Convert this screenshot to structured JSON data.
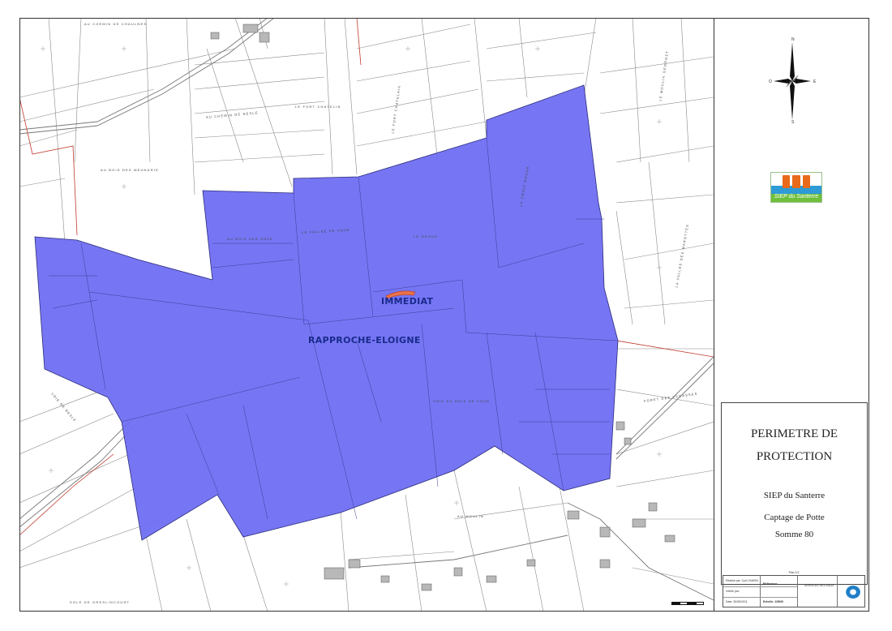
{
  "title": {
    "line1": "PERIMETRE DE",
    "line2": "PROTECTION",
    "organization": "SIEP du Santerre",
    "project": "Captage de Potte",
    "department": "Somme 80"
  },
  "logo": {
    "text": "SIEP du Santerre",
    "bar_color": "#e86a1a"
  },
  "map_labels": {
    "immediat": "IMMEDIAT",
    "rapproche": "RAPPROCHE-ELOIGNE"
  },
  "colors": {
    "protection_zone": "#6f6ff3",
    "immediate_zone": "#e8714a",
    "parcel_lines": "#7a7a7a",
    "commune_boundary": "#c0392b"
  },
  "place_names": [
    "AU CHEMIN DE CHAULNES",
    "AU CHEMIN DE NESLE",
    "LE FORT CHATELIN",
    "LE FORT CHATELAIN",
    "AU BOIS DES MEUNDRIE",
    "AU BOIS DES ONZE",
    "LA VALLEE DE VOUE",
    "LE GROUE",
    "LA CROIX ROUGE",
    "LE MOULIN GEORGET",
    "LA VALLEE DES MAROTTES",
    "VOIE DU BOIS DE VOUE",
    "AU MOULIN",
    "SOLE DE GRESLINCOURT",
    "VOIE DE NESLE",
    "FORET DES VECASSES"
  ],
  "north_arrow": {
    "n": "N",
    "s": "S",
    "e": "E",
    "o": "O"
  },
  "cartouche": {
    "plan": "Plan 1/1",
    "realise": "Réalisé par: Cyril JAMON",
    "verifie": "Vérifié par:",
    "date": "Date: 30/06/2011",
    "reference": "Référence:",
    "echelle": "Echelle: 1/5000",
    "company": "SERVICES DES EAUX"
  }
}
